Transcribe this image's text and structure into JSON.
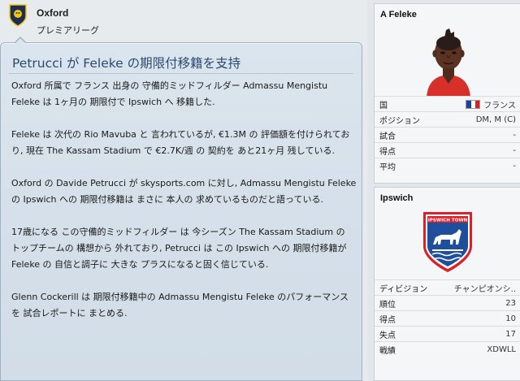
{
  "header": {
    "club_name": "Oxford",
    "league": "プレミアリーグ"
  },
  "article": {
    "headline": "Petrucci が Feleke の期限付移籍を支持",
    "paragraphs": [
      "Oxford 所属で フランス 出身の 守備的ミッドフィルダー Admassu Mengistu Feleke は 1ヶ月の 期限付で Ipswich へ 移籍した.",
      "Feleke は 次代の Rio Mavuba と 言われているが, €1.3M の 評価額を付けられており, 現在 The Kassam Stadium で €2.7K/週 の 契約を あと21ヶ月 残している.",
      "Oxford の Davide Petrucci が skysports.com に対し, Admassu Mengistu Feleke の Ipswich への 期限付移籍は まさに 本人の 求めているものだと語っている.",
      "17歳になる この守備的ミッドフィルダー は 今シーズン The Kassam Stadium の トップチームの 構想から 外れており, Petrucci は この Ipswich への 期限付移籍が Feleke の 自信と調子に 大きな プラスになると固く信じている.",
      "Glenn Cockerill は 期限付移籍中の Admassu Mengistu Feleke のパフォーマンスを 試合レポートに まとめる."
    ]
  },
  "player_panel": {
    "title": "A Feleke",
    "rows": [
      {
        "label": "国",
        "value": "フランス"
      },
      {
        "label": "ポジション",
        "value": "DM, M (C)"
      },
      {
        "label": "試合",
        "value": "-"
      },
      {
        "label": "得点",
        "value": "-"
      },
      {
        "label": "平均",
        "value": "-"
      }
    ]
  },
  "club_panel": {
    "title": "Ipswich",
    "crest_text": "IPSWICH TOWN",
    "rows": [
      {
        "label": "ディビジョン",
        "value": "チャンピオンシ.."
      },
      {
        "label": "順位",
        "value": "23"
      },
      {
        "label": "得点",
        "value": "10"
      },
      {
        "label": "失点",
        "value": "17"
      },
      {
        "label": "戦績",
        "value": "XDWLL"
      }
    ]
  },
  "colors": {
    "headline": "#2a4a6e",
    "card_border": "#9fb2c4",
    "crest_blue": "#1f4e9c",
    "crest_red": "#d8212a"
  }
}
